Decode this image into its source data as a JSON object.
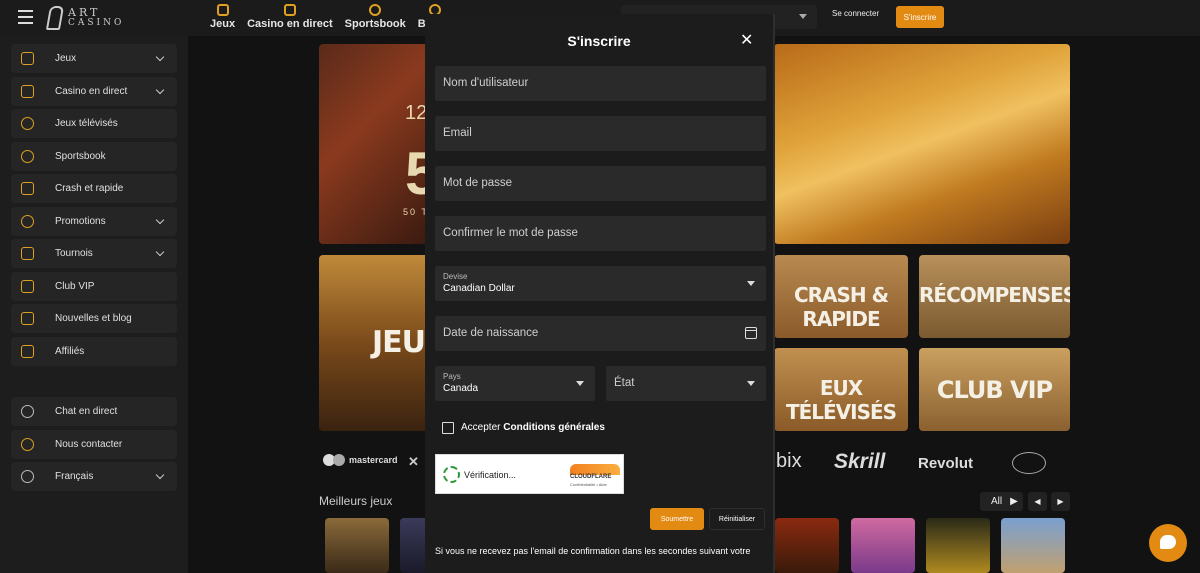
{
  "header": {
    "logo_line1": "ART",
    "logo_line2": "CASINO",
    "nav": [
      "Jeux",
      "Casino en direct",
      "Sportsbook",
      "Bonus"
    ],
    "login_label": "Se connecter",
    "signup_label": "S'inscrire"
  },
  "sidebar": {
    "items": [
      {
        "label": "Jeux",
        "icon": "slot-icon",
        "chevron": true
      },
      {
        "label": "Casino en direct",
        "icon": "cards-icon",
        "chevron": true
      },
      {
        "label": "Jeux télévisés",
        "icon": "dollar-icon",
        "chevron": false
      },
      {
        "label": "Sportsbook",
        "icon": "ball-icon",
        "chevron": false
      },
      {
        "label": "Crash et rapide",
        "icon": "rocket-icon",
        "chevron": false
      },
      {
        "label": "Promotions",
        "icon": "percent-icon",
        "chevron": true
      },
      {
        "label": "Tournois",
        "icon": "ticket-icon",
        "chevron": true
      },
      {
        "label": "Club VIP",
        "icon": "crown-icon",
        "chevron": false
      },
      {
        "label": "Nouvelles et blog",
        "icon": "chat-icon",
        "chevron": false
      },
      {
        "label": "Affiliés",
        "icon": "megaphone-icon",
        "chevron": false
      }
    ],
    "bottom_items": [
      {
        "label": "Chat en direct",
        "icon": "headset-icon",
        "chevron": false
      },
      {
        "label": "Nous contacter",
        "icon": "message-icon",
        "chevron": false
      },
      {
        "label": "Français",
        "icon": "globe-icon",
        "chevron": true
      }
    ]
  },
  "main": {
    "banner_number": "12",
    "banner_big": "5",
    "banner_small": "50 T",
    "tiles": {
      "jeux": "JEU",
      "crash": "CRASH & RAPIDE",
      "recompenses": "RÉCOMPENSES",
      "tv": "EUX TÉLÉVISÉS",
      "vip": "CLUB VIP"
    },
    "payments": {
      "mastercard": "mastercard",
      "bix": "bix",
      "skrill": "Skrill",
      "revolut": "Revolut"
    },
    "best_games_title": "Meilleurs jeux",
    "all_label": "All"
  },
  "modal": {
    "title": "S'inscrire",
    "fields": {
      "username": "Nom d'utilisateur",
      "email": "Email",
      "password": "Mot de passe",
      "confirm": "Confirmer le mot de passe",
      "currency_label": "Devise",
      "currency_value": "Canadian Dollar",
      "birthdate": "Date de naissance",
      "country_label": "Pays",
      "country_value": "Canada",
      "state": "État"
    },
    "accept_prefix": "Accepter",
    "accept_link": "Conditions générales",
    "captcha": {
      "status": "Vérification...",
      "brand": "CLOUDFLARE",
      "links": "Confidentialité • Aide"
    },
    "submit_label": "Soumettre",
    "reset_label": "Réinitialiser",
    "footer_text": "Si vous ne recevez pas l'email de confirmation dans les secondes suivant votre"
  },
  "colors": {
    "accent": "#e38a12",
    "icon": "#e0a020"
  }
}
